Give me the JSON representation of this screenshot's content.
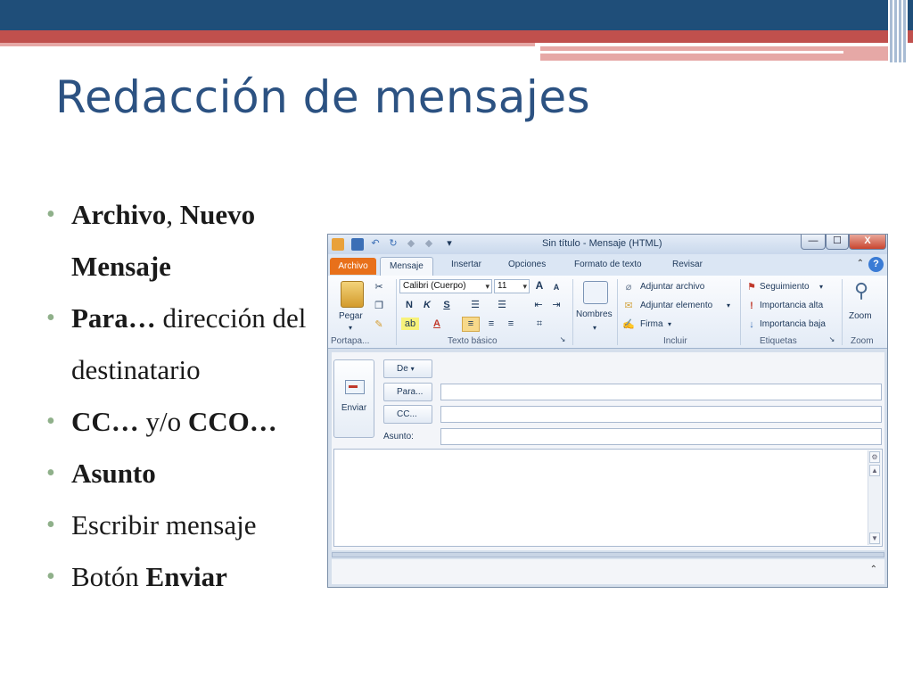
{
  "slide": {
    "title": "Redacción de mensajes",
    "bullets": [
      {
        "b1": "Archivo",
        "t1": ", ",
        "b2": "Nuevo Mensaje",
        "t2": ""
      },
      {
        "b1": "Para…",
        "t1": " dirección del destinatario",
        "b2": "",
        "t2": ""
      },
      {
        "b1": "CC…",
        "t1": " y/o ",
        "b2": "CCO…",
        "t2": ""
      },
      {
        "b1": "Asunto",
        "t1": "",
        "b2": "",
        "t2": ""
      },
      {
        "b1": "",
        "t1": "Escribir mensaje",
        "b2": "",
        "t2": ""
      },
      {
        "b1": "",
        "t1": "Botón ",
        "b2": "Enviar",
        "t2": ""
      }
    ]
  },
  "window": {
    "title": "Sin título - Mensaje (HTML)",
    "min_label": "—",
    "max_label": "☐",
    "close_label": "X",
    "help_label": "?",
    "collapse_label": "⌃"
  },
  "tabs": {
    "file": "Archivo",
    "items": [
      "Mensaje",
      "Insertar",
      "Opciones",
      "Formato de texto",
      "Revisar"
    ]
  },
  "ribbon": {
    "clipboard": {
      "paste": "Pegar",
      "label": "Portapa..."
    },
    "basic_text": {
      "font": "Calibri (Cuerpo)",
      "size": "11",
      "bold": "N",
      "italic": "K",
      "underline": "S",
      "label": "Texto básico"
    },
    "names": {
      "label": "Nombres"
    },
    "include": {
      "attach_file": "Adjuntar archivo",
      "attach_item": "Adjuntar elemento",
      "signature": "Firma",
      "label": "Incluir"
    },
    "tags": {
      "followup": "Seguimiento",
      "high": "Importancia alta",
      "low": "Importancia baja",
      "label": "Etiquetas"
    },
    "zoom": {
      "button": "Zoom",
      "label": "Zoom"
    }
  },
  "compose": {
    "send": "Enviar",
    "from": "De",
    "to": "Para...",
    "cc": "CC...",
    "subject": "Asunto:",
    "to_value": "",
    "cc_value": "",
    "subject_value": ""
  },
  "colors": {
    "title": "#2c5282",
    "header_dark": "#1f4e79",
    "header_red": "#c0504d",
    "bullet": "#8fb08a",
    "file_tab": "#e8701a"
  }
}
